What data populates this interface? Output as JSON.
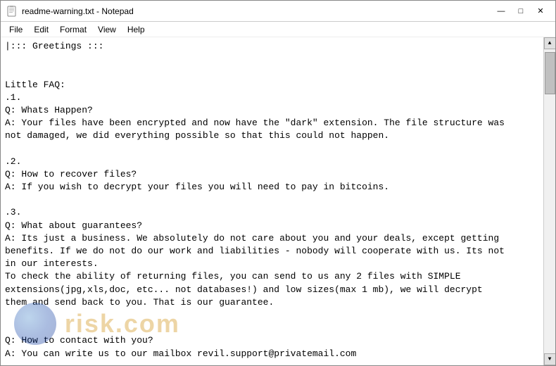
{
  "window": {
    "title": "readme-warning.txt - Notepad",
    "icon": "notepad"
  },
  "titlebar": {
    "minimize_label": "—",
    "maximize_label": "□",
    "close_label": "✕"
  },
  "menubar": {
    "items": [
      "File",
      "Edit",
      "Format",
      "View",
      "Help"
    ]
  },
  "content": {
    "text": "|::: Greetings :::\n\n\nLittle FAQ:\n.1.\nQ: Whats Happen?\nA: Your files have been encrypted and now have the \"dark\" extension. The file structure was\nnot damaged, we did everything possible so that this could not happen.\n\n.2.\nQ: How to recover files?\nA: If you wish to decrypt your files you will need to pay in bitcoins.\n\n.3.\nQ: What about guarantees?\nA: Its just a business. We absolutely do not care about you and your deals, except getting\nbenefits. If we do not do our work and liabilities - nobody will cooperate with us. Its not\nin our interests.\nTo check the ability of returning files, you can send to us any 2 files with SIMPLE\nextensions(jpg,xls,doc, etc... not databases!) and low sizes(max 1 mb), we will decrypt\nthem and send back to you. That is our guarantee.\n\n\nQ: How to contact with you?\nA: You can write us to our mailbox revil.support@privatemail.com"
  },
  "watermark": {
    "text": "risk.com"
  }
}
